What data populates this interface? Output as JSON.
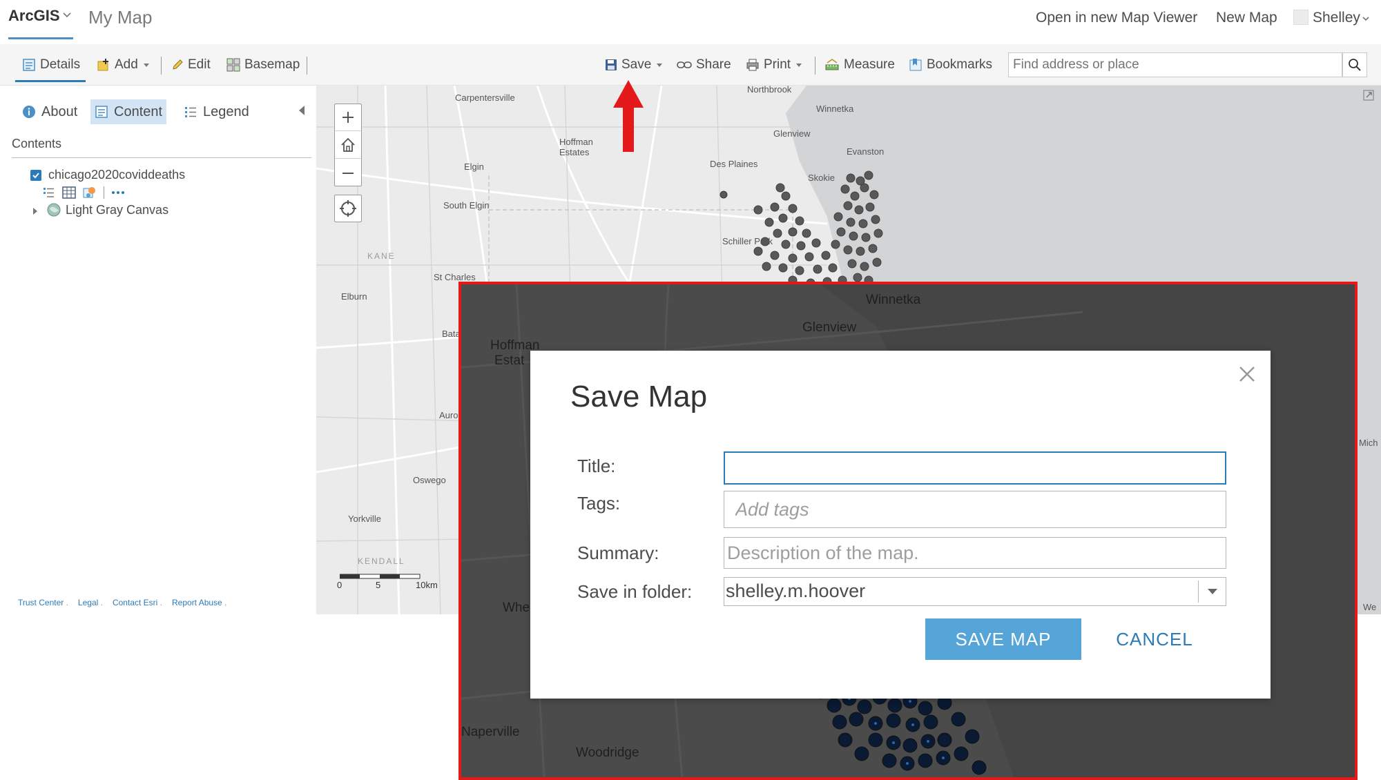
{
  "header": {
    "brand": "ArcGIS",
    "map_title": "My Map",
    "links": [
      "Open in new Map Viewer",
      "New Map"
    ],
    "user_name": "Shelley"
  },
  "toolbar": {
    "details": "Details",
    "add": "Add",
    "edit": "Edit",
    "basemap": "Basemap",
    "save": "Save",
    "share": "Share",
    "print": "Print",
    "measure": "Measure",
    "bookmarks": "Bookmarks",
    "search_placeholder": "Find address or place"
  },
  "panel": {
    "tabs": [
      "About",
      "Content",
      "Legend"
    ],
    "active_tab": "Content",
    "contents_heading": "Contents",
    "layers": [
      {
        "name": "chicago2020coviddeaths",
        "checked": true
      },
      {
        "name": "Light Gray Canvas",
        "type": "basemap"
      }
    ],
    "footer_links": [
      "Trust Center",
      "Legal",
      "Contact Esri",
      "Report Abuse"
    ]
  },
  "map": {
    "place_labels": [
      "Carpentersville",
      "Northbrook",
      "Winnetka",
      "Glenview",
      "Hoffman Estates",
      "Evanston",
      "Des Plaines",
      "Skokie",
      "Elgin",
      "South Elgin",
      "Schiller Park",
      "KANE",
      "St Charles",
      "Elburn",
      "Batavia",
      "Aurora",
      "Oswego",
      "Yorkville",
      "KENDALL",
      "Mich",
      "We"
    ],
    "scale_labels": [
      "0",
      "5",
      "10km"
    ],
    "overlay_labels": [
      "Winnetka",
      "Glenview",
      "Hoffman",
      "Estat",
      "Whe",
      "Naperville",
      "Woodridge"
    ]
  },
  "dialog": {
    "title": "Save Map",
    "fields": {
      "title_label": "Title:",
      "title_value": "",
      "tags_label": "Tags:",
      "tags_placeholder": "Add tags",
      "summary_label": "Summary:",
      "summary_placeholder": "Description of the map.",
      "folder_label": "Save in folder:",
      "folder_value": "shelley.m.hoover"
    },
    "save_button": "SAVE MAP",
    "cancel_button": "CANCEL"
  },
  "colors": {
    "accent": "#2b7bb9",
    "save_button": "#56a5d8",
    "highlight_border": "#e3191b",
    "arrow": "#e3191b",
    "point_fill": "#555555",
    "point_fill_overlay": "#0a3a78"
  },
  "icons": [
    "chevron-down-icon",
    "details-icon",
    "add-layer-icon",
    "pencil-icon",
    "basemap-grid-icon",
    "save-disk-icon",
    "share-link-icon",
    "printer-icon",
    "measure-icon",
    "bookmarks-icon",
    "search-icon",
    "info-icon",
    "content-icon",
    "legend-icon",
    "zoom-in-icon",
    "home-icon",
    "zoom-out-icon",
    "locate-icon",
    "close-icon",
    "red-arrow-icon"
  ]
}
